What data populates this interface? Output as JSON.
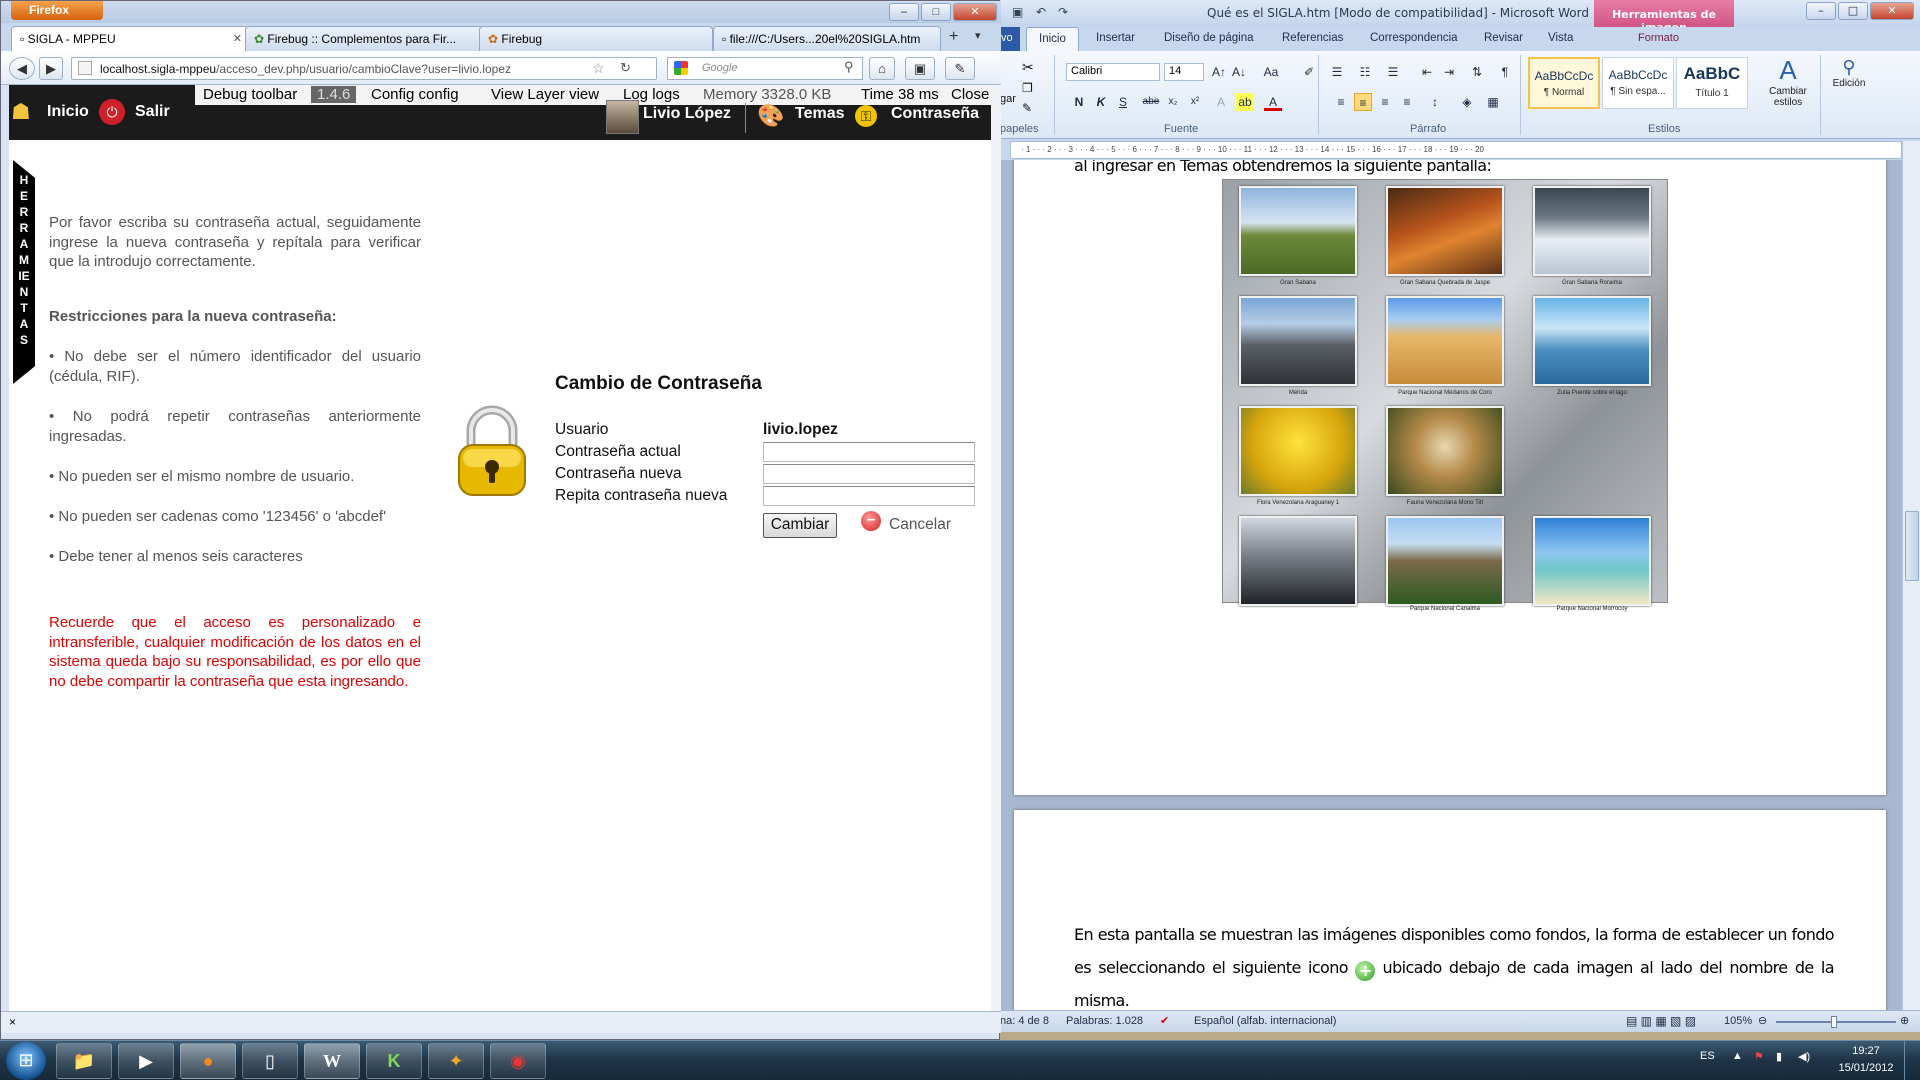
{
  "word": {
    "window_title": "Qué es el SIGLA.htm [Modo de compatibilidad] - Microsoft Word",
    "contextual_tab": "Herramientas de imagen",
    "contextual_subtab": "Formato",
    "file_tab": "vo",
    "tabs": [
      "Inicio",
      "Insertar",
      "Diseño de página",
      "Referencias",
      "Correspondencia",
      "Revisar",
      "Vista"
    ],
    "font_name": "Calibri",
    "font_size": "14",
    "groups": {
      "clipboard": "papeles",
      "font": "Fuente",
      "paragraph": "Párrafo",
      "styles": "Estilos"
    },
    "paste_label": "gar",
    "styles": [
      {
        "sample": "AaBbCcDc",
        "name": "¶ Normal"
      },
      {
        "sample": "AaBbCcDc",
        "name": "¶ Sin espa..."
      },
      {
        "sample": "AaBbC",
        "name": "Título 1"
      }
    ],
    "change_styles": "Cambiar estilos",
    "editing": "Edición",
    "ruler_marks": "· 1 · · · 2 · · · 3 · · · 4 · · · 5 · · · 6 · · · 7 · · · 8 · · · 9 · · · 10 · · · 11 · · · 12 · · · 13 · · · 14 · · · 15 · · · 16 · · · 17 · · · 18 · · · 19 · · · 20",
    "doc_top_fragment": "al ingresar en Temas obtendremos la siguiente pantalla:",
    "gallery_captions": [
      "Gran Sabana",
      "Gran Sabana Quebrada de Jaspe",
      "Gran Sabana Roraima",
      "Mérida",
      "Parque Nacional Médanos de Coro",
      "Zulia Puente sobre el lago",
      "Flora Venezolana Araguaney 1",
      "Fauna Venezolana Mono Tití",
      "",
      "",
      "Parque Nacional Canaima",
      "Parque Nacional Morrocoy"
    ],
    "paragraph_before_icon": "En esta pantalla se muestran las imágenes disponibles como fondos, la forma de establecer un fondo es seleccionando el siguiente icono",
    "paragraph_after_icon": "ubicado debajo de cada imagen al lado del nombre de la misma.",
    "status": {
      "page": "na: 4 de 8",
      "words": "Palabras: 1.028",
      "language": "Español (alfab. internacional)",
      "zoom": "105%"
    }
  },
  "firefox": {
    "app_button": "Firefox",
    "tabs": [
      {
        "title": "SIGLA - MPPEU"
      },
      {
        "title": "Firebug :: Complementos para Fir..."
      },
      {
        "title": "Firebug"
      },
      {
        "title": "file:///C:/Users...20el%20SIGLA.htm"
      }
    ],
    "url_host": "localhost.sigla-mppeu",
    "url_path": "/acceso_dev.php/usuario/cambioClave?user=livio.lopez",
    "search_placeholder": "Google",
    "status_close": "×"
  },
  "app": {
    "home": "Inicio",
    "logout": "Salir",
    "user_name": "Livio López",
    "themes": "Temas",
    "password": "Contraseña",
    "debug": {
      "toolbar": "Debug toolbar",
      "version": "1.4.6",
      "config": "Config config",
      "view_layer": "View Layer view",
      "logs": "Log logs",
      "memory": "Memory 3328.0 KB",
      "time": "Time 38 ms",
      "close": "Close"
    },
    "side_tab": "HERRAMIENTAS",
    "instructions": "Por favor escriba su contraseña actual, seguidamente ingrese la nueva contraseña y repítala para verificar que la introdujo correctamente.",
    "restrictions_title": "Restricciones para la nueva contraseña:",
    "restrictions": [
      "• No debe ser el número identificador del usuario (cédula, RIF).",
      "• No podrá repetir contraseñas anteriormente ingresadas.",
      "• No pueden ser el mismo nombre de usuario.",
      "• No pueden ser cadenas como '123456' o 'abcdef'",
      "• Debe tener al menos seis caracteres"
    ],
    "warning": "Recuerde que el acceso es personalizado e intransferible, cualquier modificación de los datos en el sistema queda bajo su responsabilidad, es por ello que no debe compartir la contraseña que esta ingresando.",
    "form": {
      "title": "Cambio de Contraseña",
      "user_label": "Usuario",
      "user_value": "livio.lopez",
      "current_label": "Contraseña actual",
      "new_label": "Contraseña nueva",
      "repeat_label": "Repita contraseña nueva",
      "submit": "Cambiar",
      "cancel": "Cancelar"
    }
  },
  "taskbar": {
    "language": "ES",
    "time": "19:27",
    "date": "15/01/2012"
  }
}
